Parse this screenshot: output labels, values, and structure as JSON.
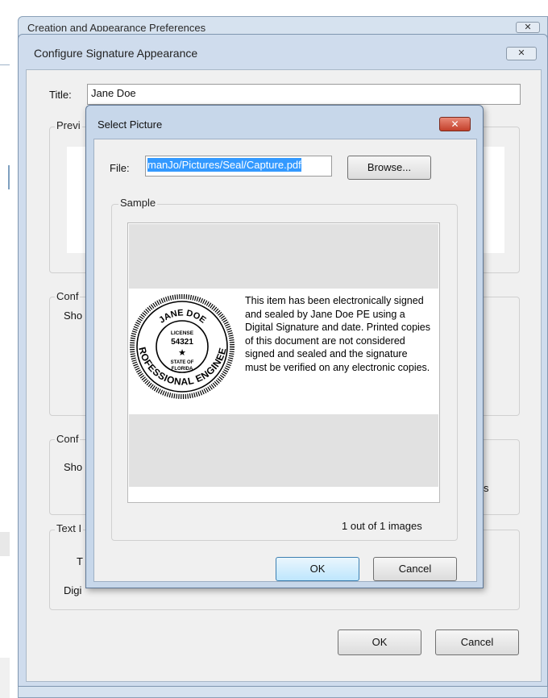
{
  "back_window": {
    "title": "Creation and Appearance Preferences",
    "close_glyph": "✕"
  },
  "configure_window": {
    "title": "Configure Signature Appearance",
    "close_glyph": "✕",
    "title_label": "Title:",
    "title_value": "Jane Doe",
    "groups": {
      "preview": "Previ",
      "configure_graphic": "Conf",
      "show_graphic": "Sho",
      "configure_text": "Conf",
      "show_text": "Sho",
      "text_properties": "Text I",
      "text_direction_partial": "T",
      "digits_partial": "Digi",
      "right_partial": "s"
    },
    "ok_label": "OK",
    "cancel_label": "Cancel"
  },
  "select_picture": {
    "title": "Select Picture",
    "close_glyph": "✕",
    "file_label": "File:",
    "file_value": "manJo/Pictures/Seal/Capture.pdf",
    "browse_label": "Browse...",
    "sample_label": "Sample",
    "seal": {
      "top_text": "JANE DOE",
      "license": "LICENSE",
      "number": "54321",
      "state_of": "STATE OF",
      "state": "FLORIDA",
      "bottom_text": "PROFESSIONAL ENGINEER"
    },
    "certification_text": "This item has been electronically signed and sealed by Jane Doe PE using a Digital Signature and date. Printed copies of this document are not considered signed and sealed and the signature must be verified on any electronic copies.",
    "image_count": "1 out of 1 images",
    "ok_label": "OK",
    "cancel_label": "Cancel"
  }
}
